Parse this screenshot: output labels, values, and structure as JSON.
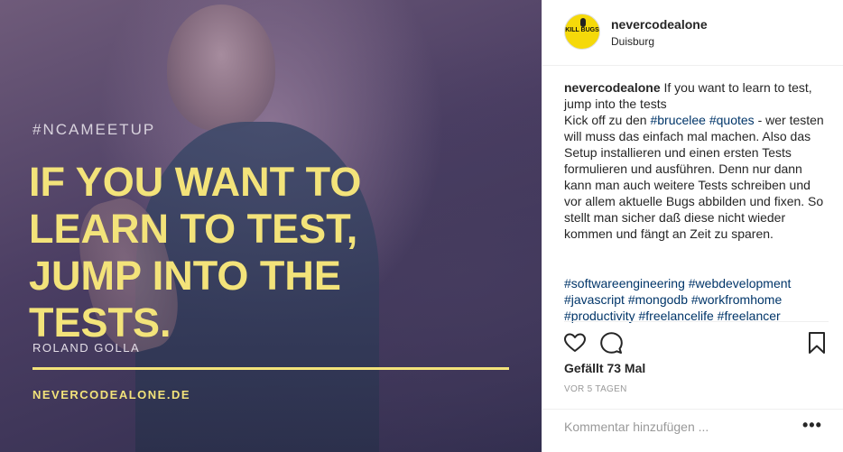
{
  "post_image": {
    "hashtag": "#NCAMEETUP",
    "quote_lines": [
      "IF YOU WANT TO",
      "LEARN TO TEST,",
      "JUMP INTO THE",
      "TESTS."
    ],
    "author": "ROLAND GOLLA",
    "website": "NEVERCODEALONE.DE",
    "accent_color": "#f3e37a"
  },
  "header": {
    "avatar_text": "KILL BUGS",
    "username": "nevercodealone",
    "location": "Duisburg"
  },
  "caption": {
    "username": "nevercodealone",
    "text_intro": "If you want to learn to test, jump into the tests",
    "text_kickoff": "Kick off zu den",
    "tag_brucelee": "#brucelee",
    "tag_quotes": "#quotes",
    "text_body": "- wer testen will muss das einfach mal machen. Also das Setup installieren und einen ersten Tests formulieren und ausführen. Denn nur dann kann man auch weitere Tests schreiben und vor allem aktuelle Bugs abbilden und fixen. So stellt man sicher daß diese nicht wieder kommen und fängt an Zeit zu sparen."
  },
  "hashtags": [
    "#softwareengineering",
    "#webdevelopment",
    "#javascript",
    "#mongodb",
    "#workfromhome",
    "#productivity",
    "#freelancelife",
    "#freelancer"
  ],
  "actions": {
    "like_icon": "heart-icon",
    "comment_icon": "comment-bubble-icon",
    "save_icon": "bookmark-icon"
  },
  "likes": "Gefällt 73 Mal",
  "timestamp": "VOR 5 TAGEN",
  "comment": {
    "placeholder": "Kommentar hinzufügen ...",
    "more_label": "•••"
  }
}
